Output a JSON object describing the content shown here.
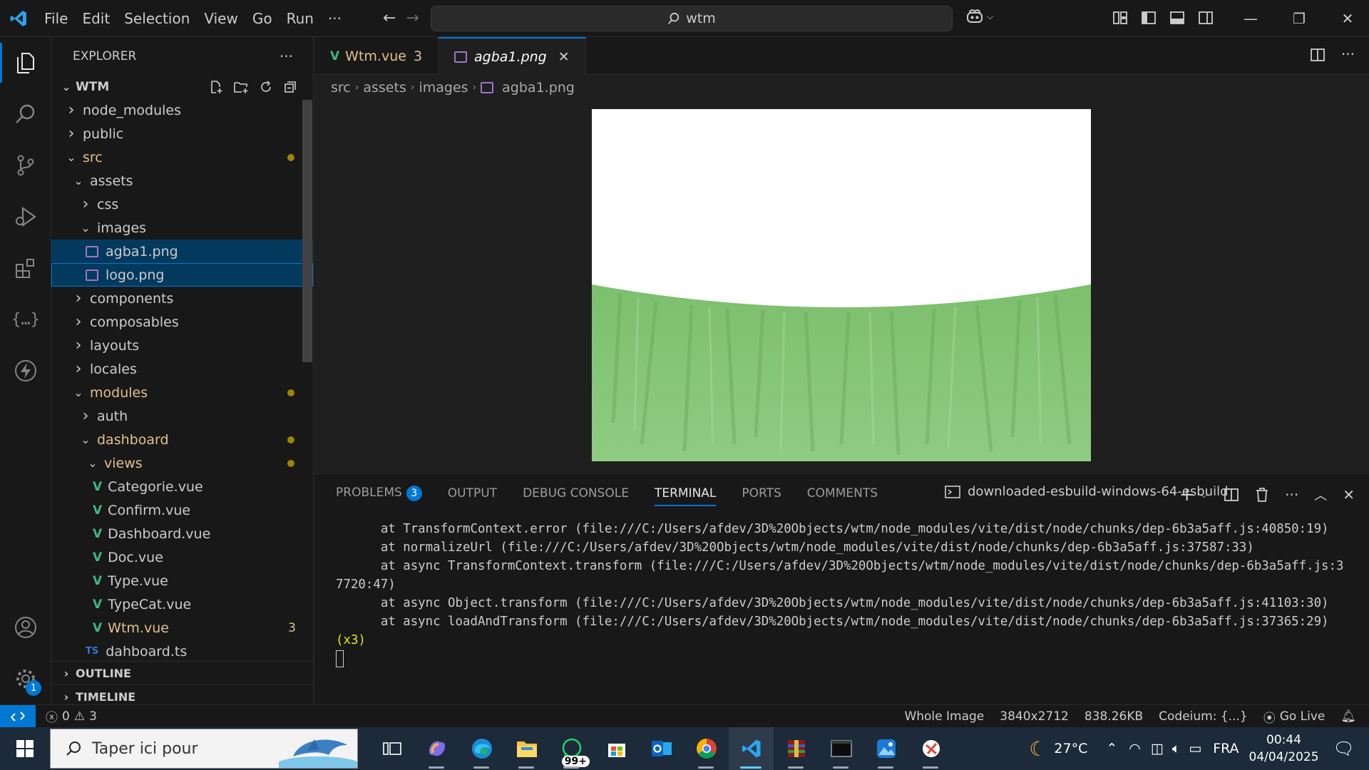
{
  "titlebar": {
    "menu": [
      "File",
      "Edit",
      "Selection",
      "View",
      "Go",
      "Run"
    ],
    "more": "···",
    "search_text": "wtm"
  },
  "explorer": {
    "title": "EXPLORER",
    "more": "···",
    "root": "WTM",
    "tree": [
      {
        "label": "node_modules",
        "depth": 0,
        "kind": "folder-closed",
        "git": false
      },
      {
        "label": "public",
        "depth": 0,
        "kind": "folder-closed",
        "git": false
      },
      {
        "label": "src",
        "depth": 0,
        "kind": "folder-open",
        "git": true,
        "dot": true
      },
      {
        "label": "assets",
        "depth": 1,
        "kind": "folder-open",
        "git": false
      },
      {
        "label": "css",
        "depth": 2,
        "kind": "folder-closed",
        "git": false
      },
      {
        "label": "images",
        "depth": 2,
        "kind": "folder-open",
        "git": false
      },
      {
        "label": "agba1.png",
        "depth": 3,
        "kind": "image",
        "git": false,
        "state": "sel"
      },
      {
        "label": "logo.png",
        "depth": 3,
        "kind": "image",
        "git": false,
        "state": "focus"
      },
      {
        "label": "components",
        "depth": 1,
        "kind": "folder-closed",
        "git": false
      },
      {
        "label": "composables",
        "depth": 1,
        "kind": "folder-closed",
        "git": false
      },
      {
        "label": "layouts",
        "depth": 1,
        "kind": "folder-closed",
        "git": false
      },
      {
        "label": "locales",
        "depth": 1,
        "kind": "folder-closed",
        "git": false
      },
      {
        "label": "modules",
        "depth": 1,
        "kind": "folder-open",
        "git": true,
        "dot": true
      },
      {
        "label": "auth",
        "depth": 2,
        "kind": "folder-closed",
        "git": false
      },
      {
        "label": "dashboard",
        "depth": 2,
        "kind": "folder-open",
        "git": true,
        "dot": true
      },
      {
        "label": "views",
        "depth": 3,
        "kind": "folder-open",
        "git": true,
        "dot": true
      },
      {
        "label": "Categorie.vue",
        "depth": 4,
        "kind": "vue",
        "git": false
      },
      {
        "label": "Confirm.vue",
        "depth": 4,
        "kind": "vue",
        "git": false
      },
      {
        "label": "Dashboard.vue",
        "depth": 4,
        "kind": "vue",
        "git": false
      },
      {
        "label": "Doc.vue",
        "depth": 4,
        "kind": "vue",
        "git": false
      },
      {
        "label": "Type.vue",
        "depth": 4,
        "kind": "vue",
        "git": false
      },
      {
        "label": "TypeCat.vue",
        "depth": 4,
        "kind": "vue",
        "git": false
      },
      {
        "label": "Wtm.vue",
        "depth": 4,
        "kind": "vue",
        "git": true,
        "count": "3"
      },
      {
        "label": "dahboard.ts",
        "depth": 3,
        "kind": "ts",
        "git": false
      }
    ],
    "outline": "OUTLINE",
    "timeline": "TIMELINE"
  },
  "tabs": [
    {
      "label": "Wtm.vue",
      "count": "3",
      "kind": "vue"
    },
    {
      "label": "agba1.png",
      "kind": "image",
      "close": "✕"
    }
  ],
  "breadcrumb": [
    "src",
    "assets",
    "images",
    "agba1.png"
  ],
  "panel": {
    "tabs": [
      "PROBLEMS",
      "OUTPUT",
      "DEBUG CONSOLE",
      "TERMINAL",
      "PORTS",
      "COMMENTS"
    ],
    "problems_count": "3",
    "active_tab": "TERMINAL",
    "terminal_title": "downloaded-esbuild-windows-64-esbuild",
    "more": "···",
    "lines": [
      "      at TransformContext.error (file:///C:/Users/afdev/3D%20Objects/wtm/node_modules/vite/dist/node/chunks/dep-6b3a5aff.js:40850:19)",
      "      at normalizeUrl (file:///C:/Users/afdev/3D%20Objects/wtm/node_modules/vite/dist/node/chunks/dep-6b3a5aff.js:37587:33)",
      "      at async TransformContext.transform (file:///C:/Users/afdev/3D%20Objects/wtm/node_modules/vite/dist/node/chunks/dep-6b3a5aff.js:37720:47)",
      "      at async Object.transform (file:///C:/Users/afdev/3D%20Objects/wtm/node_modules/vite/dist/node/chunks/dep-6b3a5aff.js:41103:30)",
      "      at async loadAndTransform (file:///C:/Users/afdev/3D%20Objects/wtm/node_modules/vite/dist/node/chunks/dep-6b3a5aff.js:37365:29)"
    ],
    "repeat": " (x3)"
  },
  "status": {
    "errors": "0",
    "warnings": "3",
    "image_mode": "Whole Image",
    "dimensions": "3840x2712",
    "size": "838.26KB",
    "codeium": "Codeium: {...}",
    "golive": "Go Live"
  },
  "taskbar": {
    "search_placeholder": "Taper ici pour",
    "whatsapp_badge": "99+",
    "weather": "27°C",
    "lang": "FRA",
    "time": "00:44",
    "date": "04/04/2025"
  },
  "activity": {
    "settings_badge": "1"
  },
  "colors": {
    "accent": "#0078d4",
    "git_modified": "#e2c08d",
    "vue": "#41b883",
    "image_green": "#86c47a"
  }
}
